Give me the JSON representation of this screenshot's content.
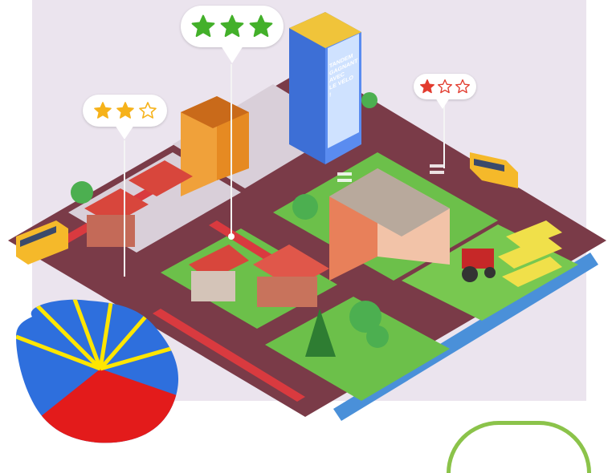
{
  "scene": {
    "description_tag": "isometric-city-bike-map",
    "billboard_lines": [
      "TANDEM",
      "GAGNANT",
      "AVEC",
      "LE VÉLO !"
    ]
  },
  "ratings": [
    {
      "id": "left",
      "filled": 2,
      "total": 3,
      "color": "#f6b21a"
    },
    {
      "id": "center",
      "filled": 3,
      "total": 3,
      "color": "#43b02a"
    },
    {
      "id": "right",
      "filled": 1,
      "total": 3,
      "color": "#e23b2e"
    }
  ],
  "colors": {
    "ground": "#ebe4ee",
    "road": "#7a3b48",
    "bike_lane": "#d93a3f",
    "grass": "#6cc04a",
    "water": "#4a90d9",
    "flag_blue": "#2e6fdd",
    "flag_red": "#e31b1b",
    "flag_yellow": "#ffe600",
    "badge_green": "#8bc34a"
  }
}
